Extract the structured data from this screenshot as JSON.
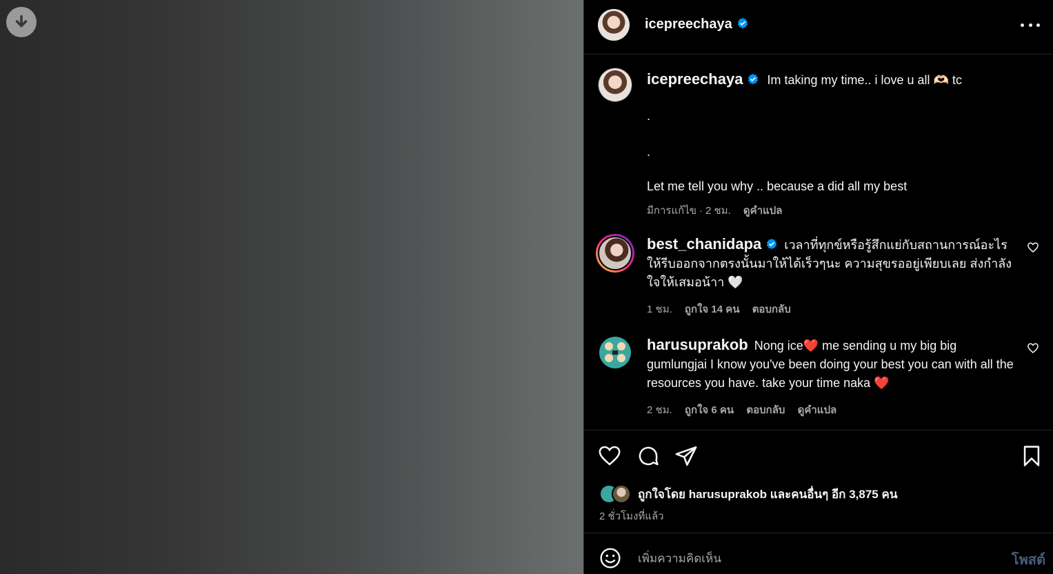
{
  "media": {
    "download_icon": "arrow-down-circle-icon"
  },
  "header": {
    "username": "icepreechaya",
    "more_icon": "more-horizontal-icon"
  },
  "caption": {
    "username": "icepreechaya",
    "text": "Im taking my time.. i love u all 🫶🏻 tc",
    "lines": [
      ".",
      ".",
      "Let me tell you why .. because a did all my best"
    ],
    "edited": "มีการแก้ไข",
    "time": "2 ชม.",
    "translate": "ดูคำแปล"
  },
  "comments": [
    {
      "username": "best_chanidapa",
      "text": "เวลาที่ทุกข์หรือรู้สึกแย่กับสถานการณ์อะไรให้รีบออกจากตรงนั้นมาให้ได้เร็วๆนะ ความสุขรออยู่เพียบเลย ส่งกำลังใจให้เสมอน้าา 🤍",
      "time": "1 ชม.",
      "likes": "ถูกใจ 14 คน",
      "reply": "ตอบกลับ"
    },
    {
      "username": "harusuprakob",
      "text": "Nong ice❤️ me sending u my big big gumlungjai I know you've been doing your best you can with all the resources you have. take your time naka ❤️",
      "time": "2 ชม.",
      "likes": "ถูกใจ 6 คน",
      "reply": "ตอบกลับ",
      "translate": "ดูคำแปล"
    }
  ],
  "actions": {
    "icons": [
      "heart-icon",
      "comment-icon",
      "share-icon",
      "bookmark-icon"
    ],
    "likes_text": "ถูกใจโดย harusuprakob และคนอื่นๆ อีก 3,875 คน",
    "time_ago": "2 ชั่วโมงที่แล้ว"
  },
  "comment_box": {
    "placeholder": "เพิ่มความคิดเห็น",
    "post_label": "โพสต์"
  },
  "colors": {
    "verified": "#0095f6",
    "link": "#4a5d7a"
  }
}
